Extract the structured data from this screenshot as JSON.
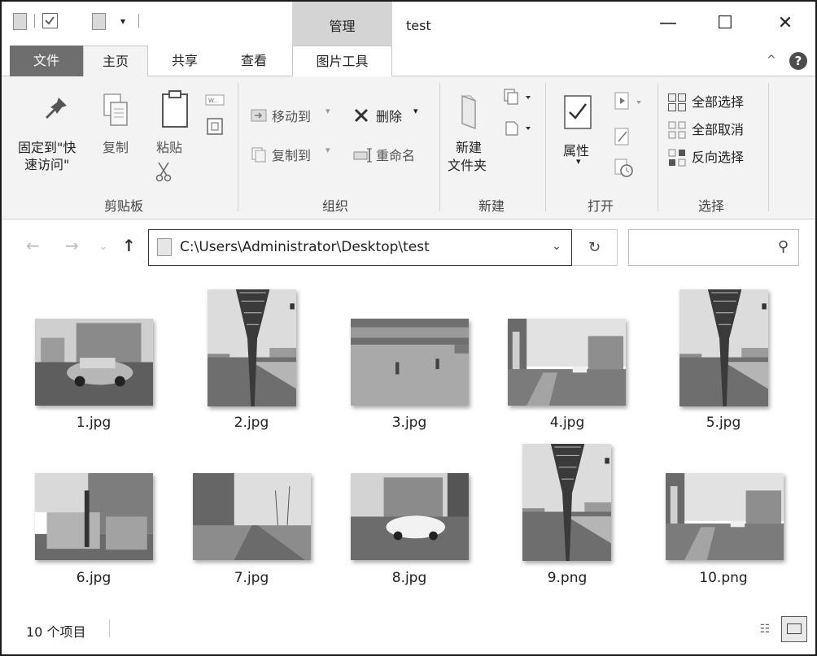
{
  "window": {
    "title": "test",
    "context_tab_group": "管理",
    "controls": {
      "minimize": "—",
      "maximize": "☐",
      "close": "✕"
    }
  },
  "quick_access": {
    "items": [
      "document-icon",
      "checkbox-icon",
      "document-icon",
      "dropdown-icon"
    ],
    "dropdown_glyph": "▾"
  },
  "tabs": [
    {
      "label": "文件",
      "selected": false
    },
    {
      "label": "主页",
      "selected": true
    },
    {
      "label": "共享",
      "selected": false
    },
    {
      "label": "查看",
      "selected": false
    },
    {
      "label": "图片工具",
      "selected": false
    }
  ],
  "ribbon_extras": {
    "collapse_glyph": "^",
    "help_glyph": "?"
  },
  "ribbon": {
    "clipboard": {
      "label": "剪贴板",
      "pin_line1": "固定到\"快",
      "pin_line2": "速访问\"",
      "copy": "复制",
      "paste": "粘贴"
    },
    "organize": {
      "label": "组织",
      "move_to": "移动到",
      "copy_to": "复制到",
      "delete": "删除",
      "rename": "重命名"
    },
    "new": {
      "label": "新建",
      "new_folder_line1": "新建",
      "new_folder_line2": "文件夹"
    },
    "open": {
      "label": "打开",
      "properties": "属性"
    },
    "select": {
      "label": "选择",
      "select_all": "全部选择",
      "select_none": "全部取消",
      "invert": "反向选择"
    }
  },
  "address_bar": {
    "path": "C:\\Users\\Administrator\\Desktop\\test",
    "search_placeholder": ""
  },
  "files": [
    {
      "name": "1.jpg",
      "scene": "car"
    },
    {
      "name": "2.jpg",
      "scene": "lamp"
    },
    {
      "name": "3.jpg",
      "scene": "plaza"
    },
    {
      "name": "4.jpg",
      "scene": "street"
    },
    {
      "name": "5.jpg",
      "scene": "lamp"
    },
    {
      "name": "6.jpg",
      "scene": "box"
    },
    {
      "name": "7.jpg",
      "scene": "road"
    },
    {
      "name": "8.jpg",
      "scene": "parked"
    },
    {
      "name": "9.png",
      "scene": "lamp"
    },
    {
      "name": "10.png",
      "scene": "street"
    }
  ],
  "status": {
    "count_text": "10 个项目"
  }
}
